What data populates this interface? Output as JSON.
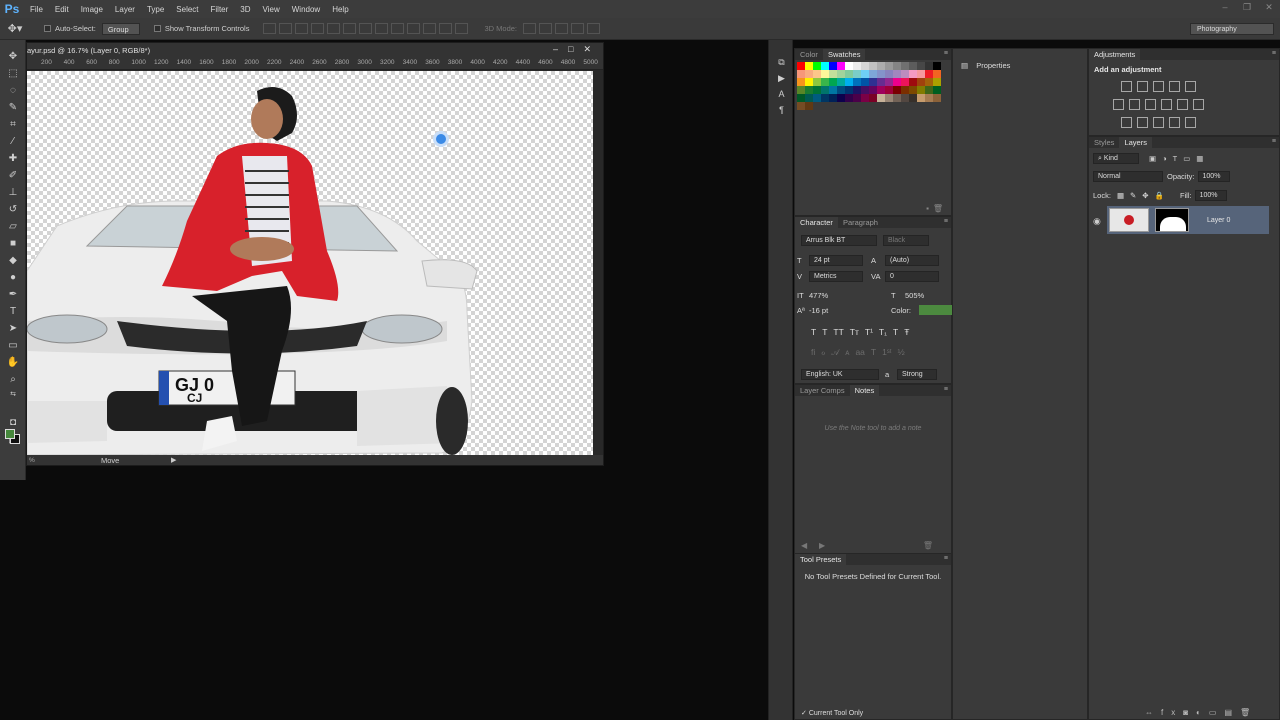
{
  "app": {
    "logo": "Ps"
  },
  "menu": [
    "File",
    "Edit",
    "Image",
    "Layer",
    "Type",
    "Select",
    "Filter",
    "3D",
    "View",
    "Window",
    "Help"
  ],
  "options_bar": {
    "auto_select_label": "Auto-Select:",
    "auto_select_value": "Group",
    "show_transform_label": "Show Transform Controls",
    "mode_3d_label": "3D Mode:",
    "workspace": "Photography"
  },
  "document": {
    "title": "ayur.psd @ 16.7% (Layer 0, RGB/8*)",
    "ruler_ticks": [
      "200",
      "400",
      "600",
      "800",
      "1000",
      "1200",
      "1400",
      "1600",
      "1800",
      "2000",
      "2200",
      "2400",
      "2600",
      "2800",
      "3000",
      "3200",
      "3400",
      "3600",
      "3800",
      "4000",
      "4200",
      "4400",
      "4600",
      "4800",
      "5000"
    ],
    "status_zoom": "%",
    "status_info": "Move",
    "plate_text": "GJ 0   7\nCJ"
  },
  "panels": {
    "color_tab": "Color",
    "swatches_tab": "Swatches",
    "properties_tab": "Properties",
    "adjustments_tab": "Adjustments",
    "add_adjustment": "Add an adjustment",
    "styles_tab": "Styles",
    "layers_tab": "Layers",
    "character_tab": "Character",
    "paragraph_tab": "Paragraph",
    "layer_comps_tab": "Layer Comps",
    "notes_tab": "Notes",
    "tool_presets_tab": "Tool Presets"
  },
  "layers": {
    "kind": "Kind",
    "blend_mode": "Normal",
    "opacity_label": "Opacity:",
    "opacity_value": "100%",
    "lock_label": "Lock:",
    "fill_label": "Fill:",
    "fill_value": "100%",
    "layer_name": "Layer 0"
  },
  "character": {
    "font_family": "Arrus Blk BT",
    "font_style": "Black",
    "font_size": "24 pt",
    "leading": "(Auto)",
    "kerning": "Metrics",
    "tracking": "0",
    "vertical_scale": "477%",
    "horizontal_scale": "505%",
    "baseline_shift": "-16 pt",
    "color_label": "Color:",
    "color_value": "#4c8a3f",
    "language": "English: UK",
    "antialias_label": "a",
    "antialias": "Strong"
  },
  "notes": {
    "placeholder": "Use the Note tool to add a note"
  },
  "tool_presets": {
    "empty_message": "No Tool Presets Defined for Current Tool.",
    "current_tool_only": "Current Tool Only"
  },
  "swatch_colors": [
    "#ff0000",
    "#ffff00",
    "#00ff00",
    "#00ffff",
    "#0000ff",
    "#ff00ff",
    "#ffffff",
    "#ebebeb",
    "#d6d6d6",
    "#c2c2c2",
    "#adadad",
    "#999999",
    "#858585",
    "#707070",
    "#5c5c5c",
    "#474747",
    "#333333",
    "#000000",
    "#f7977a",
    "#f9ad81",
    "#fdc68a",
    "#fff79a",
    "#c4df9b",
    "#a2d39c",
    "#82ca9d",
    "#7bcdc8",
    "#6ecff6",
    "#7ea7d8",
    "#8493ca",
    "#8882be",
    "#a187be",
    "#bc8dbf",
    "#f49ac2",
    "#f6989d",
    "#ed1c24",
    "#f26522",
    "#f7941d",
    "#fff200",
    "#8dc73f",
    "#39b54a",
    "#00a651",
    "#00a99d",
    "#00aeef",
    "#0072bc",
    "#0054a6",
    "#2e3192",
    "#662d91",
    "#92278f",
    "#ec008c",
    "#ed145b",
    "#9e0b0f",
    "#a0410d",
    "#a3620a",
    "#aba000",
    "#598527",
    "#1a7b30",
    "#007236",
    "#00746b",
    "#0076a3",
    "#004b80",
    "#003471",
    "#1b1464",
    "#440e62",
    "#630460",
    "#9e005d",
    "#9e0039",
    "#790000",
    "#7b2e00",
    "#7d4900",
    "#827b00",
    "#406618",
    "#005e20",
    "#005826",
    "#005952",
    "#005b7f",
    "#003663",
    "#002157",
    "#0d004c",
    "#32004b",
    "#4b0049",
    "#7b0046",
    "#7a0026",
    "#c7b299",
    "#998675",
    "#736357",
    "#534741",
    "#37302a",
    "#c69c6d",
    "#a67c52",
    "#8c6239",
    "#754c24",
    "#603913",
    "#3a3a3a",
    "#3a3a3a",
    "#3a3a3a",
    "#3a3a3a",
    "#3a3a3a",
    "#3a3a3a",
    "#3a3a3a",
    "#3a3a3a"
  ]
}
